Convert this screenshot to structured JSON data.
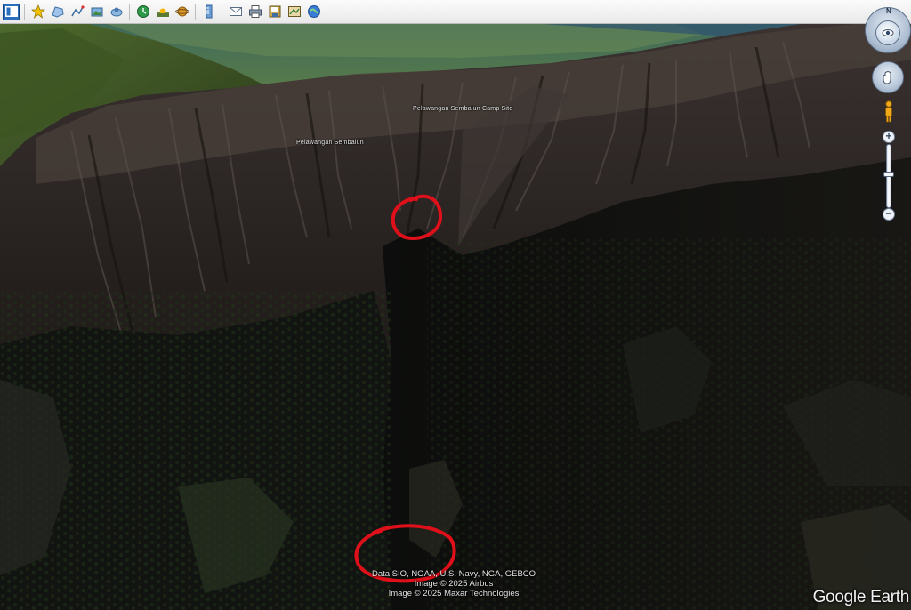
{
  "toolbar": {
    "buttons": [
      {
        "name": "sidebar-toggle-icon",
        "active": true
      },
      {
        "name": "add-placemark-icon"
      },
      {
        "name": "add-polygon-icon"
      },
      {
        "name": "add-path-icon"
      },
      {
        "name": "add-image-overlay-icon"
      },
      {
        "name": "record-tour-icon"
      },
      {
        "name": "historical-imagery-icon"
      },
      {
        "name": "sunlight-icon"
      },
      {
        "name": "switch-to-sky-icon"
      },
      {
        "name": "ruler-icon"
      },
      {
        "name": "email-icon"
      },
      {
        "name": "print-icon"
      },
      {
        "name": "save-image-icon"
      },
      {
        "name": "view-in-maps-icon"
      },
      {
        "name": "web-icon"
      }
    ]
  },
  "map": {
    "labels": {
      "camp": "Pelawangan Sembalun Camp Site",
      "rim": "Pelawangan Sembalun"
    },
    "annotation_color": "#e0101a",
    "attribution": {
      "line1": "Data SIO, NOAA, U.S. Navy, NGA, GEBCO",
      "line2": "Image © 2025 Airbus",
      "line3": "Image © 2025 Maxar Technologies"
    },
    "brand": "Google Earth"
  },
  "nav": {
    "north_label": "N"
  }
}
